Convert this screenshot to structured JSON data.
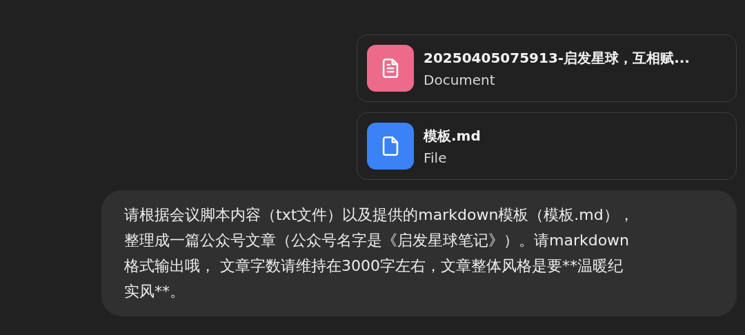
{
  "attachments": [
    {
      "kind": "document",
      "name": "20250405075913-启发星球，互相赋...",
      "type": "Document"
    },
    {
      "kind": "file",
      "name": "模板.md",
      "type": "File"
    }
  ],
  "message": {
    "text": "请根据会议脚本内容（txt文件）以及提供的markdown模板（模板.md），整理成一篇公众号文章（公众号名字是《启发星球笔记》）。请markdown格式输出哦， 文章字数请维持在3000字左右，文章整体风格是要**温暖纪实风**。"
  }
}
